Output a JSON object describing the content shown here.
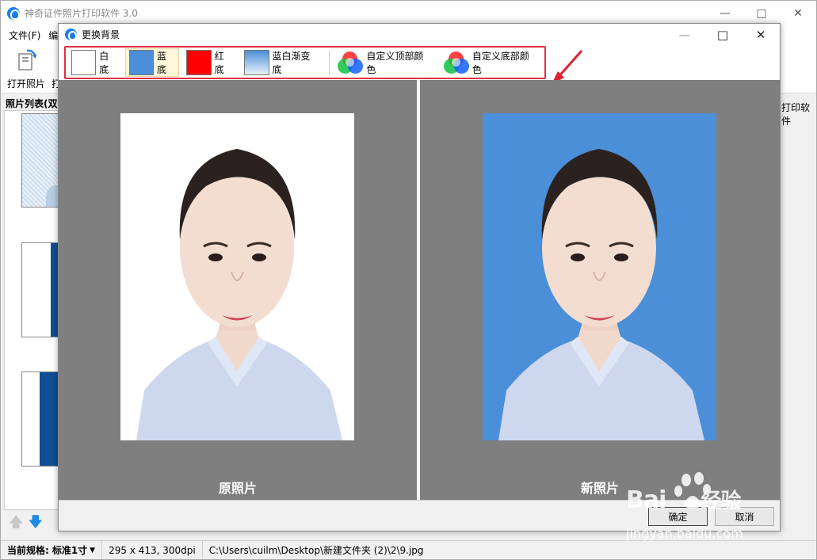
{
  "main_window": {
    "title": "神奇证件照片打印软件 3.0",
    "menu_file": "文件(F)",
    "menu_cut": "编",
    "open_photo_label": "打开照片",
    "toolbar_cut": "打",
    "photo_list_header": "照片列表(双",
    "right_panel_label": "打印软件"
  },
  "statusbar": {
    "spec_label": "当前规格:",
    "spec_value": "标准1寸",
    "dimensions": "295 x 413, 300dpi",
    "file_path": "C:\\Users\\cuilm\\Desktop\\新建文件夹 (2)\\2\\9.jpg"
  },
  "dialog": {
    "title": "更换背景",
    "options": [
      {
        "label": "白底",
        "color": "#ffffff"
      },
      {
        "label": "蓝底",
        "color": "#4a8fd8",
        "selected": true
      },
      {
        "label": "红底",
        "color": "#ff0000"
      },
      {
        "label": "蓝白渐变底",
        "color": "#4a8fd8"
      },
      {
        "label": "自定义顶部颜色"
      },
      {
        "label": "自定义底部颜色"
      }
    ],
    "original_caption": "原照片",
    "new_caption": "新照片",
    "ok_label": "确定",
    "cancel_label": "取消"
  },
  "watermark": {
    "brand": "Bai",
    "brand_suffix": "经验",
    "url": "jingyan.baidu.com"
  },
  "colors": {
    "highlight_border": "#e03040",
    "preview_bg": "#7f7f7f",
    "blue_background": "#4a8fd8"
  }
}
